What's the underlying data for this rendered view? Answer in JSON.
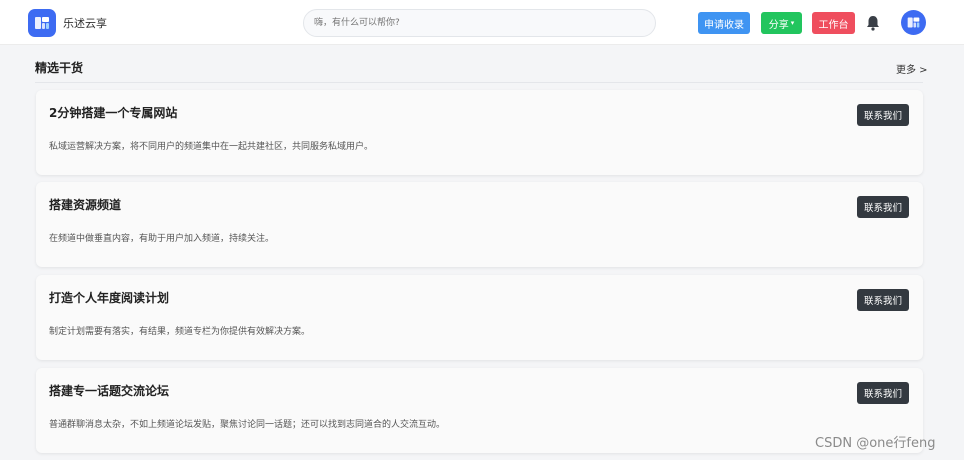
{
  "header": {
    "brand": "乐述云享",
    "search_placeholder": "嗨，有什么可以帮你?",
    "apply_label": "申请收录",
    "share_label": "分享",
    "work_label": "工作台",
    "icons": {
      "logo": "logo-icon",
      "bell": "bell-icon",
      "avatar": "avatar"
    }
  },
  "section": {
    "title": "精选干货",
    "more": "更多 >"
  },
  "cards": [
    {
      "title": "2分钟搭建一个专属网站",
      "desc": "私域运营解决方案，将不同用户的频道集中在一起共建社区，共同服务私域用户。",
      "button": "联系我们"
    },
    {
      "title": "搭建资源频道",
      "desc": "在频道中做垂直内容，有助于用户加入频道，持续关注。",
      "button": "联系我们"
    },
    {
      "title": "打造个人年度阅读计划",
      "desc": "制定计划需要有落实，有结果，频道专栏为你提供有效解决方案。",
      "button": "联系我们"
    },
    {
      "title": "搭建专一话题交流论坛",
      "desc": "普通群聊消息太杂，不如上频道论坛发贴，聚焦讨论同一话题；还可以找到志同道合的人交流互动。",
      "button": "联系我们"
    }
  ],
  "watermark": "CSDN @one行feng",
  "colors": {
    "apply": "#3f94f2",
    "share": "#22c55e",
    "work": "#ef4e5e",
    "brand": "#3d6bf2",
    "dark_button": "#333940"
  }
}
